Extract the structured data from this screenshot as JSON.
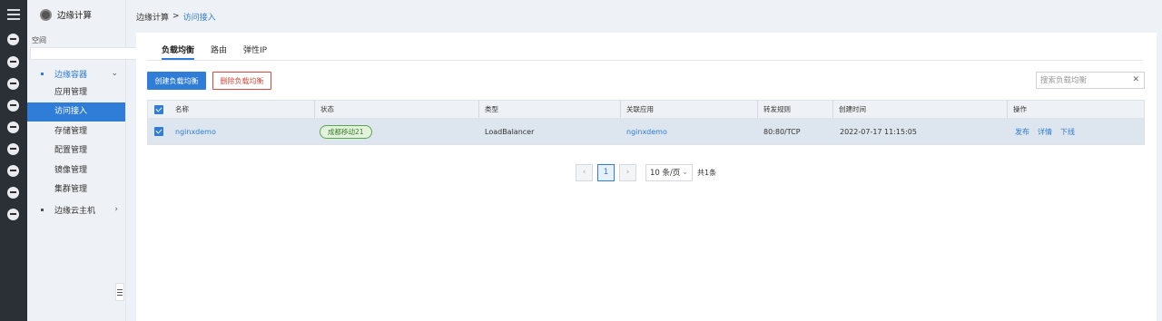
{
  "rail": {
    "icons": [
      "menu-icon",
      "circle-icon",
      "robot-icon",
      "triangle-icon",
      "cloud-icon",
      "stack-icon",
      "database-icon",
      "cloud-upload-icon",
      "mail-icon",
      "grid-icon"
    ]
  },
  "sidebar": {
    "title": "边缘计算",
    "space_label": "空间",
    "space_value": "",
    "groups": [
      {
        "label": "边缘容器",
        "expanded": true
      },
      {
        "label": "边缘云主机",
        "expanded": false
      }
    ],
    "items": [
      {
        "label": "应用管理",
        "active": false
      },
      {
        "label": "访问接入",
        "active": true
      },
      {
        "label": "存储管理",
        "active": false
      },
      {
        "label": "配置管理",
        "active": false
      },
      {
        "label": "镜像管理",
        "active": false
      },
      {
        "label": "集群管理",
        "active": false
      }
    ]
  },
  "breadcrumb": {
    "root": "边缘计算",
    "separator": ">",
    "current": "访问接入"
  },
  "tabs": [
    {
      "label": "负载均衡",
      "active": true
    },
    {
      "label": "路由",
      "active": false
    },
    {
      "label": "弹性IP",
      "active": false
    }
  ],
  "toolbar": {
    "create_label": "创建负载均衡",
    "delete_label": "删除负载均衡",
    "search_placeholder": "搜索负载均衡",
    "clear_glyph": "✕"
  },
  "table": {
    "columns": [
      "名称",
      "状态",
      "类型",
      "关联应用",
      "转发规则",
      "创建时间",
      "操作"
    ],
    "rows": [
      {
        "name": "nginxdemo",
        "status": "成都移动21",
        "type": "LoadBalancer",
        "app": "nginxdemo",
        "rule": "80:80/TCP",
        "created": "2022-07-17 11:15:05",
        "actions": [
          "发布",
          "详情",
          "下线"
        ]
      }
    ]
  },
  "pagination": {
    "prev": "‹",
    "page": "1",
    "next": "›",
    "page_size": "10 条/页",
    "total": "共1条"
  },
  "colors": {
    "accent": "#2f7dd6",
    "danger": "#d4493b",
    "status_green": "#5aa84a",
    "rail_bg": "#2b2f36"
  }
}
